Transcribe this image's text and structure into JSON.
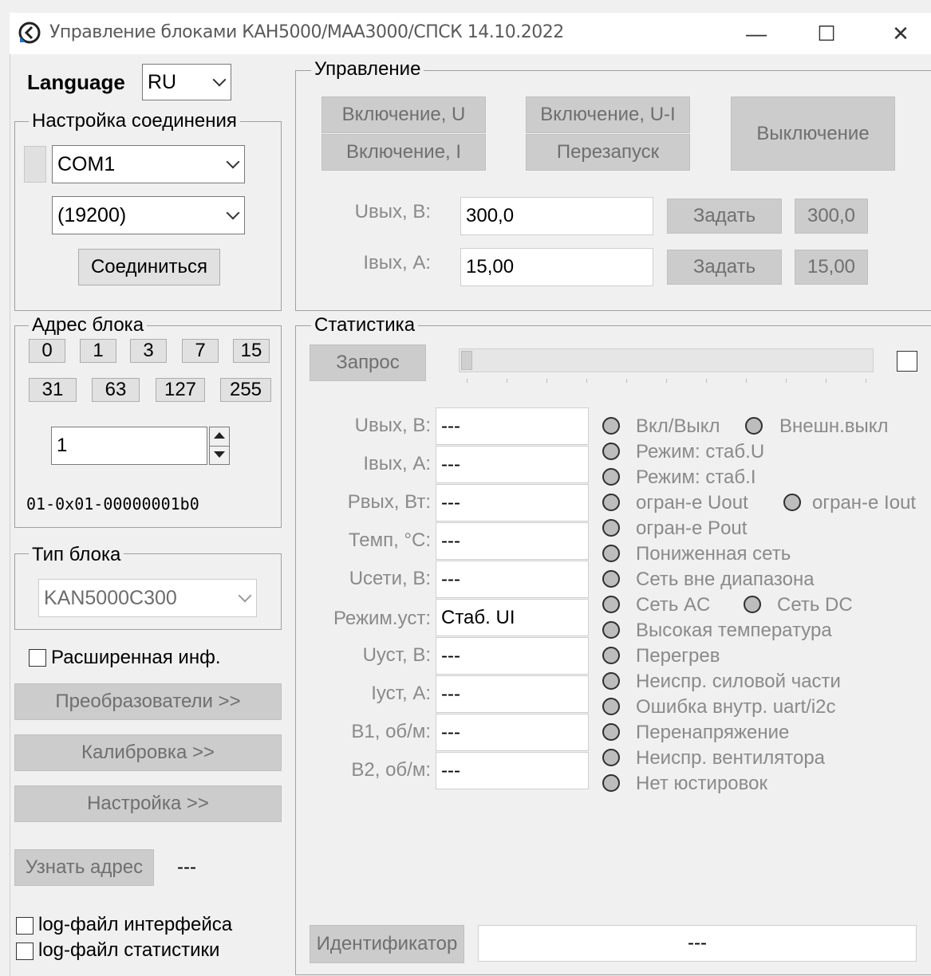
{
  "window": {
    "title": "Управление блоками КАН5000/МАА3000/СПСК 14.10.2022",
    "minimize_glyph": "—",
    "maximize_glyph": "☐",
    "close_glyph": "✕"
  },
  "left": {
    "language_label": "Language",
    "language_value": "RU",
    "connection": {
      "legend": "Настройка соединения",
      "port": "COM1",
      "baud": "(19200)",
      "connect_button": "Соединиться"
    },
    "address": {
      "legend": "Адрес блока",
      "buttons_row1": [
        "0",
        "1",
        "3",
        "7",
        "15"
      ],
      "buttons_row2": [
        "31",
        "63",
        "127",
        "255"
      ],
      "spin_value": "1",
      "code": "01-0x01-00000001b0"
    },
    "block_type": {
      "legend": "Тип блока",
      "value": "KAN5000C300"
    },
    "extended_info_label": "Расширенная инф.",
    "converters_button": "Преобразователи >>",
    "calibration_button": "Калибровка >>",
    "settings_button": "Настройка >>",
    "find_address_button": "Узнать адрес",
    "find_address_value": "---",
    "log_interface_label": "log-файл интерфейса",
    "log_stats_label": "log-файл статистики"
  },
  "control": {
    "legend": "Управление",
    "on_u_button": "Включение, U",
    "on_ui_button": "Включение, U-I",
    "on_i_button": "Включение, I",
    "restart_button": "Перезапуск",
    "off_button": "Выключение",
    "uout_label": "Uвых, В:",
    "uout_value": "300,0",
    "uout_set_button": "Задать",
    "uout_current": "300,0",
    "iout_label": "Iвых, А:",
    "iout_value": "15,00",
    "iout_set_button": "Задать",
    "iout_current": "15,00"
  },
  "stats": {
    "legend": "Статистика",
    "request_button": "Запрос",
    "progress_fraction": 0.0,
    "fields": [
      {
        "label": "Uвых, В:",
        "value": "---"
      },
      {
        "label": "Iвых, А:",
        "value": "---"
      },
      {
        "label": "Рвых, Вт:",
        "value": "---"
      },
      {
        "label": "Темп, °С:",
        "value": "---"
      },
      {
        "label": "Uсети, В:",
        "value": "---"
      },
      {
        "label": "Режим.уст:",
        "value": "Стаб. UI"
      },
      {
        "label": "Uуст, В:",
        "value": "---"
      },
      {
        "label": "Iуст, А:",
        "value": "---"
      },
      {
        "label": "В1, об/м:",
        "value": "---"
      },
      {
        "label": "В2, об/м:",
        "value": "---"
      }
    ],
    "indicators": {
      "on_off": "Вкл/Выкл",
      "ext_off": "Внешн.выкл",
      "mode_u": "Режим: стаб.U",
      "mode_i": "Режим: стаб.I",
      "limit_uout": "огран-е Uout",
      "limit_iout": "огран-е Iout",
      "limit_pout": "огран-е Pout",
      "low_grid": "Пониженная сеть",
      "grid_out_of_range": "Сеть вне диапазона",
      "grid_ac": "Сеть AC",
      "grid_dc": "Сеть DC",
      "high_temp": "Высокая температура",
      "overheat": "Перегрев",
      "power_fault": "Неиспр. силовой части",
      "uart_error": "Ошибка внутр. uart/i2c",
      "overvoltage": "Перенапряжение",
      "fan_fault": "Неиспр. вентилятора",
      "no_calibration": "Нет юстировок"
    },
    "id_button": "Идентификатор",
    "id_value": "---"
  }
}
